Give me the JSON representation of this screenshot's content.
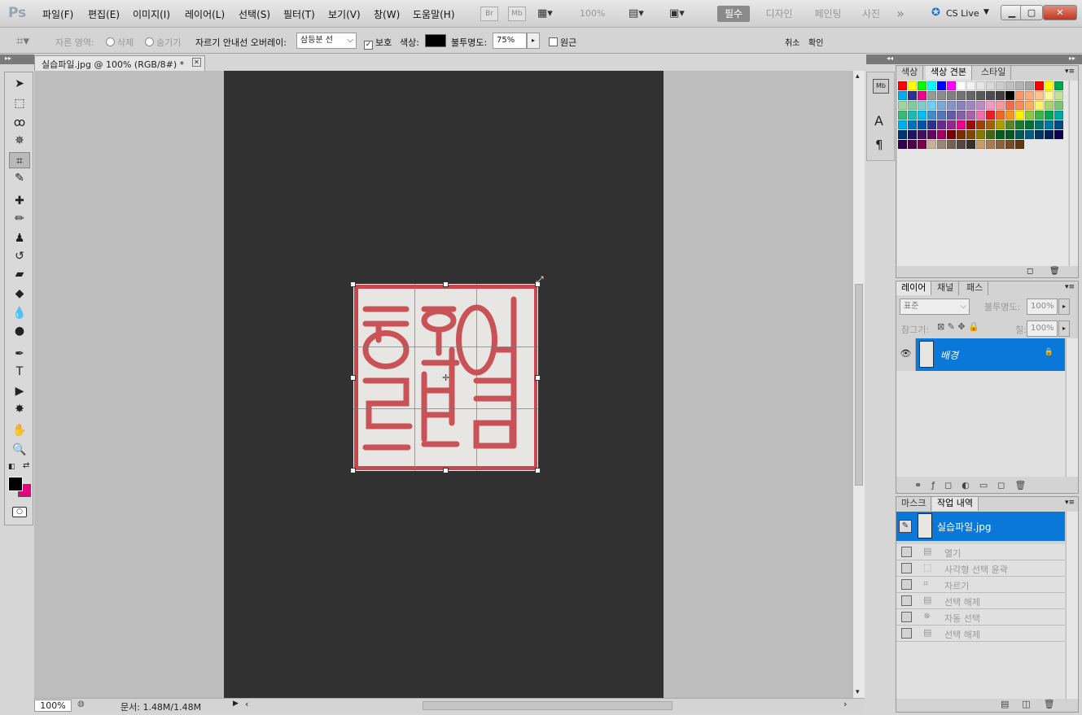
{
  "app": {
    "logo": "Ps"
  },
  "menu": [
    "파일(F)",
    "편집(E)",
    "이미지(I)",
    "레이어(L)",
    "선택(S)",
    "필터(T)",
    "보기(V)",
    "창(W)",
    "도움말(H)"
  ],
  "menubar_right": {
    "br": "Br",
    "mb": "Mb",
    "zoom": "100%",
    "workspaces": [
      "필수",
      "디자인",
      "페인팅",
      "사진"
    ],
    "more": "»",
    "cslive": "CS Live"
  },
  "options": {
    "crop_area_label": "자른 영역:",
    "delete": "삭제",
    "hide": "숨기기",
    "overlay_label": "자르기 안내선 오버레이:",
    "overlay_value": "삼등분 선",
    "shield": "보호",
    "color_label": "색상:",
    "opacity_label": "불투명도:",
    "opacity_value": "75%",
    "perspective": "원근",
    "cancel": "취소",
    "ok": "확인"
  },
  "document": {
    "tab_title": "실습파일.jpg @ 100% (RGB/8#) *",
    "zoom": "100%",
    "doc_info": "문서: 1.48M/1.48M"
  },
  "swatches_panel": {
    "tabs": [
      "색상",
      "색상 견본",
      "스타일"
    ],
    "active": 1
  },
  "swatch_colors": [
    "#ff0000",
    "#ffff00",
    "#00ff00",
    "#00ffff",
    "#0000ff",
    "#ff00ff",
    "#ffffff",
    "#f2f2f2",
    "#e6e6e6",
    "#d9d9d9",
    "#cccccc",
    "#bfbfbf",
    "#b3b3b3",
    "#a6a6a6",
    "#ff0000",
    "#ffff00",
    "#00a651",
    "#00aeef",
    "#2e3192",
    "#ec008c",
    "#999999",
    "#8c8c8c",
    "#808080",
    "#737373",
    "#666666",
    "#595959",
    "#4d4d4d",
    "#404040",
    "#000000",
    "#f7976a",
    "#f9ad81",
    "#fdc68a",
    "#fff799",
    "#c4df9b",
    "#a2d39c",
    "#82ca9d",
    "#7bcdc8",
    "#6ecff6",
    "#7ea7d8",
    "#8493ca",
    "#8882be",
    "#a187be",
    "#bc8dbf",
    "#f49ac2",
    "#f6989d",
    "#f26c4f",
    "#f68e55",
    "#fbaf5c",
    "#fff467",
    "#acd372",
    "#7cc576",
    "#3bb878",
    "#1abbb4",
    "#00bff3",
    "#438ccb",
    "#5574b9",
    "#605ca8",
    "#855fa8",
    "#a763a8",
    "#f06eaa",
    "#ed1c24",
    "#f26522",
    "#f7941d",
    "#fff200",
    "#8dc73f",
    "#39b54a",
    "#00a651",
    "#00a99d",
    "#00aeef",
    "#0072bc",
    "#0054a6",
    "#2e3192",
    "#662d91",
    "#92278f",
    "#ec008c",
    "#9e0b0f",
    "#a0410d",
    "#a36209",
    "#aba000",
    "#598527",
    "#1a7b30",
    "#007236",
    "#00746b",
    "#0076a3",
    "#004b80",
    "#003471",
    "#1b1464",
    "#440e62",
    "#630460",
    "#9e005d",
    "#790000",
    "#7b2e00",
    "#7d4900",
    "#827b00",
    "#406618",
    "#005e20",
    "#005826",
    "#005952",
    "#005b7f",
    "#003663",
    "#002157",
    "#0d004c",
    "#32004b",
    "#4b0049",
    "#7b0046",
    "#c7b299",
    "#998675",
    "#736357",
    "#534741",
    "#37302d",
    "#c69c6d",
    "#a67c52",
    "#8c6239",
    "#754c24",
    "#603913"
  ],
  "layers_panel": {
    "tabs": [
      "레이어",
      "채널",
      "패스"
    ],
    "blend": "표준",
    "opacity_label": "불투명도:",
    "opacity": "100%",
    "lock_label": "잠그기:",
    "fill_label": "칠:",
    "fill": "100%",
    "layer_name": "배경"
  },
  "history_panel": {
    "tabs": [
      "마스크",
      "작업 내역"
    ],
    "snapshot": "실습파일.jpg",
    "items": [
      "열기",
      "사각형 선택 윤곽",
      "자르기",
      "선택 해제",
      "자동 선택",
      "선택 해제"
    ]
  }
}
